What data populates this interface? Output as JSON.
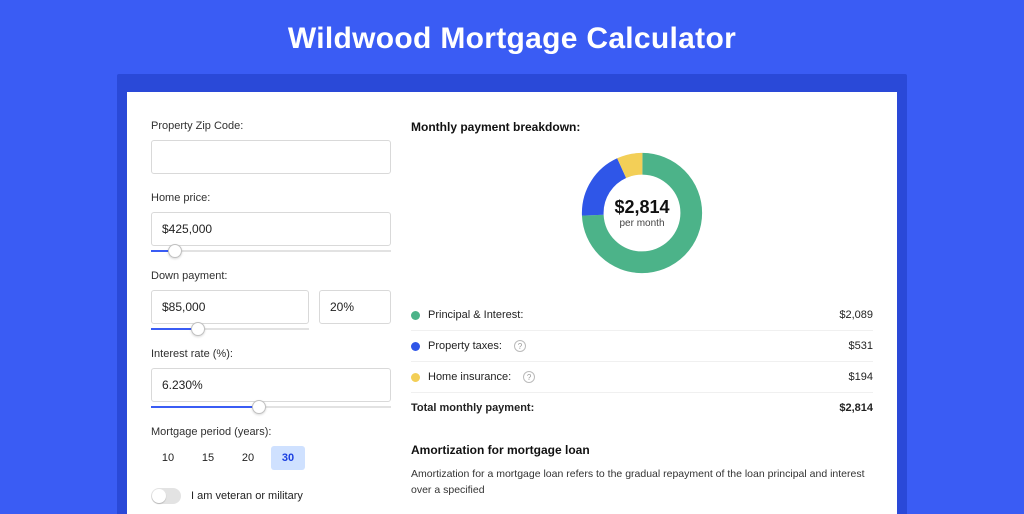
{
  "title": "Wildwood Mortgage Calculator",
  "form": {
    "zip_label": "Property Zip Code:",
    "zip_value": "",
    "price_label": "Home price:",
    "price_value": "$425,000",
    "price_slider_pct": 10,
    "down_label": "Down payment:",
    "down_value": "$85,000",
    "down_pct_value": "20%",
    "down_slider_pct": 30,
    "rate_label": "Interest rate (%):",
    "rate_value": "6.230%",
    "rate_slider_pct": 45,
    "period_label": "Mortgage period (years):",
    "periods": [
      "10",
      "15",
      "20",
      "30"
    ],
    "period_active_index": 3,
    "veteran_label": "I am veteran or military",
    "veteran_on": false
  },
  "breakdown": {
    "title": "Monthly payment breakdown:",
    "center_amount": "$2,814",
    "center_sub": "per month",
    "rows": [
      {
        "label": "Principal & Interest:",
        "value": "$2,089",
        "color": "#4cb389",
        "help": false
      },
      {
        "label": "Property taxes:",
        "value": "$531",
        "color": "#2f56e8",
        "help": true
      },
      {
        "label": "Home insurance:",
        "value": "$194",
        "color": "#f3cf57",
        "help": true
      }
    ],
    "total_label": "Total monthly payment:",
    "total_value": "$2,814"
  },
  "amort": {
    "title": "Amortization for mortgage loan",
    "text": "Amortization for a mortgage loan refers to the gradual repayment of the loan principal and interest over a specified"
  },
  "chart_data": {
    "type": "pie",
    "title": "Monthly payment breakdown",
    "series": [
      {
        "name": "Principal & Interest",
        "value": 2089,
        "color": "#4cb389"
      },
      {
        "name": "Property taxes",
        "value": 531,
        "color": "#2f56e8"
      },
      {
        "name": "Home insurance",
        "value": 194,
        "color": "#f3cf57"
      }
    ],
    "total": 2814,
    "center_label": "$2,814 per month"
  }
}
